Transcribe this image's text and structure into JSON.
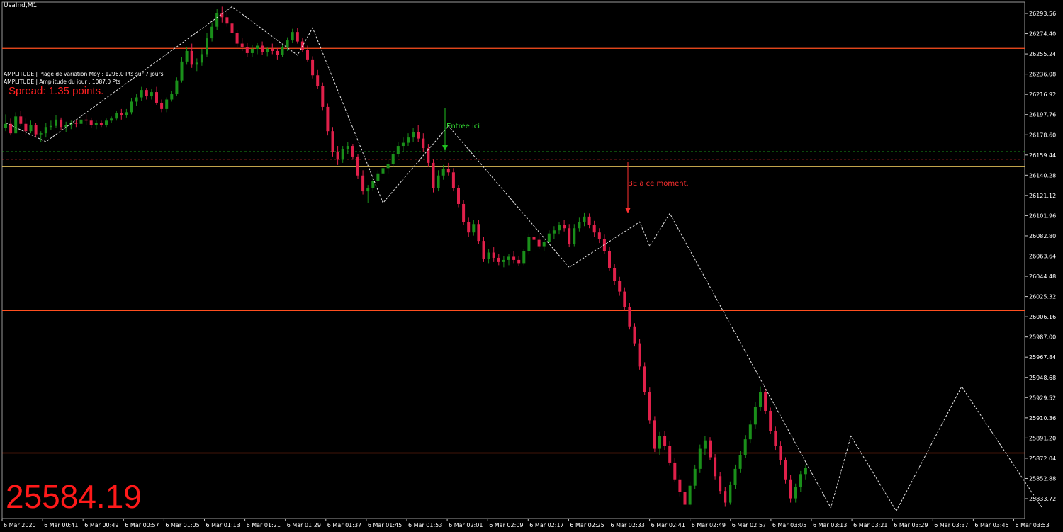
{
  "window": {
    "symbol_timeframe": "UsaInd,M1"
  },
  "overlay": {
    "amplitude_line_1": "AMPLITUDE | Plage de variation Moy : 1296.0 Pts sur 7 jours",
    "amplitude_line_2": "AMPLITUDE | Amplitude du jour : 1087.0 Pts",
    "spread": "Spread: 1.35 points.",
    "big_price": "25584.19"
  },
  "annotations": {
    "entry_label": "Entrée ici",
    "be_label": "BE à ce moment."
  },
  "colors": {
    "background": "#000000",
    "bull": "#1a8f1a",
    "bear": "#e0204a",
    "level_line": "#ff4f1f",
    "yellow_line": "#ffd966",
    "green_dotted": "#1fbf1f",
    "red_dotted": "#ff3030",
    "zigzag": "#e6e6e6",
    "text": "#ffffff",
    "price_big": "#ff1a1a"
  },
  "chart_data": {
    "type": "candlestick",
    "symbol": "UsaInd",
    "timeframe": "M1",
    "y_ticks": [
      "26293.56",
      "26274.40",
      "26255.24",
      "26236.08",
      "26216.92",
      "26197.76",
      "26178.60",
      "26159.44",
      "26140.28",
      "26121.12",
      "26101.96",
      "26082.80",
      "26063.64",
      "26044.48",
      "26025.32",
      "26006.16",
      "25987.00",
      "25967.84",
      "25948.68",
      "25929.52",
      "25910.36",
      "25891.20",
      "25872.04",
      "25852.88",
      "25833.72"
    ],
    "x_ticks": [
      "6 Mar 2020",
      "6 Mar 00:41",
      "6 Mar 00:49",
      "6 Mar 00:57",
      "6 Mar 01:05",
      "6 Mar 01:13",
      "6 Mar 01:21",
      "6 Mar 01:29",
      "6 Mar 01:37",
      "6 Mar 01:45",
      "6 Mar 01:53",
      "6 Mar 02:01",
      "6 Mar 02:09",
      "6 Mar 02:17",
      "6 Mar 02:25",
      "6 Mar 02:33",
      "6 Mar 02:41",
      "6 Mar 02:49",
      "6 Mar 02:57",
      "6 Mar 03:05",
      "6 Mar 03:13",
      "6 Mar 03:21",
      "6 Mar 03:29",
      "6 Mar 03:37",
      "6 Mar 03:45",
      "6 Mar 03:53"
    ],
    "ylim": [
      25820,
      26305
    ],
    "horizontal_levels": [
      {
        "price": 26260.5,
        "style": "solid",
        "color_key": "level_line"
      },
      {
        "price": 26148.5,
        "style": "solid",
        "color_key": "yellow_line"
      },
      {
        "price": 26162.5,
        "style": "dotted",
        "color_key": "green_dotted"
      },
      {
        "price": 26155.5,
        "style": "dotted",
        "color_key": "red_dotted"
      },
      {
        "price": 26012.0,
        "style": "solid",
        "color_key": "level_line"
      },
      {
        "price": 25877.0,
        "style": "solid",
        "color_key": "level_line"
      }
    ],
    "zigzag_points": [
      {
        "bar": 0,
        "price": 26190
      },
      {
        "bar": 8,
        "price": 26172
      },
      {
        "bar": 45,
        "price": 26300
      },
      {
        "bar": 58,
        "price": 26254
      },
      {
        "bar": 61,
        "price": 26280
      },
      {
        "bar": 75,
        "price": 26114
      },
      {
        "bar": 88,
        "price": 26187
      },
      {
        "bar": 112,
        "price": 26053
      },
      {
        "bar": 126,
        "price": 26096
      },
      {
        "bar": 128,
        "price": 26073
      },
      {
        "bar": 132,
        "price": 26104
      },
      {
        "bar": 164,
        "price": 25825
      },
      {
        "bar": 168,
        "price": 25893
      },
      {
        "bar": 177,
        "price": 25822
      },
      {
        "bar": 190,
        "price": 25940
      },
      {
        "bar": 206,
        "price": 25825
      }
    ],
    "candles": [
      [
        26185,
        26198,
        26182,
        26189
      ],
      [
        26189,
        26194,
        26178,
        26180
      ],
      [
        26180,
        26200,
        26180,
        26196
      ],
      [
        26196,
        26201,
        26187,
        26189
      ],
      [
        26189,
        26194,
        26178,
        26182
      ],
      [
        26182,
        26192,
        26180,
        26188
      ],
      [
        26188,
        26190,
        26176,
        26179
      ],
      [
        26179,
        26182,
        26172,
        26180
      ],
      [
        26180,
        26190,
        26176,
        26186
      ],
      [
        26186,
        26192,
        26183,
        26187
      ],
      [
        26187,
        26197,
        26185,
        26193
      ],
      [
        26193,
        26195,
        26183,
        26186
      ],
      [
        26186,
        26191,
        26181,
        26188
      ],
      [
        26188,
        26192,
        26184,
        26190
      ],
      [
        26190,
        26193,
        26186,
        26189
      ],
      [
        26189,
        26196,
        26187,
        26193
      ],
      [
        26193,
        26198,
        26188,
        26192
      ],
      [
        26192,
        26195,
        26185,
        26188
      ],
      [
        26188,
        26192,
        26184,
        26190
      ],
      [
        26190,
        26192,
        26186,
        26188
      ],
      [
        26188,
        26194,
        26186,
        26192
      ],
      [
        26192,
        26196,
        26190,
        26194
      ],
      [
        26194,
        26201,
        26192,
        26199
      ],
      [
        26199,
        26203,
        26193,
        26197
      ],
      [
        26197,
        26203,
        26195,
        26200
      ],
      [
        26200,
        26213,
        26198,
        26210
      ],
      [
        26210,
        26217,
        26206,
        26214
      ],
      [
        26214,
        26224,
        26211,
        26221
      ],
      [
        26221,
        26223,
        26212,
        26215
      ],
      [
        26215,
        26222,
        26212,
        26219
      ],
      [
        26219,
        26224,
        26207,
        26209
      ],
      [
        26209,
        26212,
        26200,
        26203
      ],
      [
        26203,
        26214,
        26200,
        26212
      ],
      [
        26212,
        26220,
        26210,
        26217
      ],
      [
        26217,
        26233,
        26215,
        26230
      ],
      [
        26230,
        26252,
        26228,
        26248
      ],
      [
        26248,
        26262,
        26245,
        26258
      ],
      [
        26258,
        26265,
        26242,
        26245
      ],
      [
        26245,
        26251,
        26239,
        26247
      ],
      [
        26247,
        26260,
        26244,
        26255
      ],
      [
        26255,
        26275,
        26252,
        26270
      ],
      [
        26270,
        26285,
        26267,
        26281
      ],
      [
        26281,
        26298,
        26278,
        26294
      ],
      [
        26294,
        26300,
        26285,
        26290
      ],
      [
        26290,
        26296,
        26281,
        26284
      ],
      [
        26284,
        26290,
        26272,
        26275
      ],
      [
        26275,
        26278,
        26262,
        26265
      ],
      [
        26265,
        26270,
        26258,
        26262
      ],
      [
        26262,
        26266,
        26252,
        26256
      ],
      [
        26256,
        26264,
        26252,
        26260
      ],
      [
        26260,
        26266,
        26255,
        26263
      ],
      [
        26263,
        26267,
        26254,
        26257
      ],
      [
        26257,
        26262,
        26253,
        26260
      ],
      [
        26260,
        26265,
        26255,
        26258
      ],
      [
        26258,
        26261,
        26250,
        26254
      ],
      [
        26254,
        26264,
        26252,
        26262
      ],
      [
        26262,
        26271,
        26258,
        26268
      ],
      [
        26268,
        26279,
        26266,
        26276
      ],
      [
        26276,
        26280,
        26265,
        26267
      ],
      [
        26267,
        26270,
        26257,
        26259
      ],
      [
        26259,
        26263,
        26248,
        26250
      ],
      [
        26250,
        26253,
        26232,
        26235
      ],
      [
        26235,
        26240,
        26222,
        26225
      ],
      [
        26225,
        26228,
        26202,
        26205
      ],
      [
        26205,
        26208,
        26178,
        26182
      ],
      [
        26182,
        26186,
        26158,
        26162
      ],
      [
        26162,
        26168,
        26150,
        26155
      ],
      [
        26155,
        26168,
        26152,
        26165
      ],
      [
        26165,
        26172,
        26160,
        26168
      ],
      [
        26168,
        26170,
        26155,
        26158
      ],
      [
        26158,
        26160,
        26137,
        26140
      ],
      [
        26140,
        26145,
        26122,
        26125
      ],
      [
        26125,
        26131,
        26114,
        26128
      ],
      [
        26128,
        26138,
        26125,
        26135
      ],
      [
        26135,
        26145,
        26132,
        26142
      ],
      [
        26142,
        26150,
        26138,
        26147
      ],
      [
        26147,
        26155,
        26142,
        26151
      ],
      [
        26151,
        26163,
        26148,
        26160
      ],
      [
        26160,
        26172,
        26158,
        26168
      ],
      [
        26168,
        26176,
        26163,
        26171
      ],
      [
        26171,
        26180,
        26168,
        26176
      ],
      [
        26176,
        26185,
        26172,
        26181
      ],
      [
        26181,
        26188,
        26172,
        26175
      ],
      [
        26175,
        26180,
        26162,
        26166
      ],
      [
        26166,
        26170,
        26148,
        26152
      ],
      [
        26152,
        26155,
        26124,
        26128
      ],
      [
        26128,
        26145,
        26125,
        26140
      ],
      [
        26140,
        26150,
        26136,
        26146
      ],
      [
        26146,
        26152,
        26140,
        26143
      ],
      [
        26143,
        26147,
        26125,
        26128
      ],
      [
        26128,
        26131,
        26110,
        26113
      ],
      [
        26113,
        26117,
        26093,
        26096
      ],
      [
        26096,
        26100,
        26082,
        26086
      ],
      [
        26086,
        26098,
        26083,
        26094
      ],
      [
        26094,
        26098,
        26075,
        26078
      ],
      [
        26078,
        26082,
        26058,
        26061
      ],
      [
        26061,
        26070,
        26057,
        26067
      ],
      [
        26067,
        26072,
        26058,
        26062
      ],
      [
        26062,
        26066,
        26055,
        26058
      ],
      [
        26058,
        26064,
        26053,
        26060
      ],
      [
        26060,
        26066,
        26055,
        26063
      ],
      [
        26063,
        26068,
        26057,
        26060
      ],
      [
        26060,
        26064,
        26054,
        26057
      ],
      [
        26057,
        26070,
        26055,
        26068
      ],
      [
        26068,
        26085,
        26065,
        26082
      ],
      [
        26082,
        26090,
        26076,
        26079
      ],
      [
        26079,
        26084,
        26070,
        26073
      ],
      [
        26073,
        26080,
        26068,
        26077
      ],
      [
        26077,
        26088,
        26074,
        26085
      ],
      [
        26085,
        26092,
        26080,
        26088
      ],
      [
        26088,
        26096,
        26084,
        26093
      ],
      [
        26093,
        26098,
        26087,
        26090
      ],
      [
        26090,
        26094,
        26072,
        26075
      ],
      [
        26075,
        26094,
        26073,
        26090
      ],
      [
        26090,
        26100,
        26087,
        26096
      ],
      [
        26096,
        26105,
        26092,
        26101
      ],
      [
        26101,
        26104,
        26090,
        26093
      ],
      [
        26093,
        26097,
        26082,
        26086
      ],
      [
        26086,
        26090,
        26076,
        26080
      ],
      [
        26080,
        26084,
        26066,
        26068
      ],
      [
        26068,
        26072,
        26050,
        26052
      ],
      [
        26052,
        26056,
        26036,
        26040
      ],
      [
        26040,
        26044,
        26026,
        26030
      ],
      [
        26030,
        26034,
        26012,
        26015
      ],
      [
        26015,
        26019,
        25994,
        25997
      ],
      [
        25997,
        26000,
        25978,
        25981
      ],
      [
        25981,
        25985,
        25956,
        25959
      ],
      [
        25959,
        25963,
        25932,
        25935
      ],
      [
        25935,
        25939,
        25905,
        25908
      ],
      [
        25908,
        25912,
        25878,
        25881
      ],
      [
        25881,
        25897,
        25875,
        25893
      ],
      [
        25893,
        25898,
        25880,
        25884
      ],
      [
        25884,
        25888,
        25865,
        25868
      ],
      [
        25868,
        25872,
        25850,
        25852
      ],
      [
        25852,
        25856,
        25836,
        25840
      ],
      [
        25840,
        25844,
        25825,
        25828
      ],
      [
        25828,
        25850,
        25826,
        25846
      ],
      [
        25846,
        25866,
        25843,
        25862
      ],
      [
        25862,
        25885,
        25858,
        25881
      ],
      [
        25881,
        25893,
        25875,
        25889
      ],
      [
        25889,
        25892,
        25870,
        25873
      ],
      [
        25873,
        25876,
        25852,
        25855
      ],
      [
        25855,
        25859,
        25838,
        25841
      ],
      [
        25841,
        25845,
        25826,
        25830
      ],
      [
        25830,
        25850,
        25828,
        25847
      ],
      [
        25847,
        25866,
        25843,
        25862
      ],
      [
        25862,
        25879,
        25858,
        25875
      ],
      [
        25875,
        25894,
        25872,
        25890
      ],
      [
        25890,
        25908,
        25886,
        25904
      ],
      [
        25904,
        25925,
        25900,
        25921
      ],
      [
        25921,
        25940,
        25917,
        25935
      ],
      [
        25935,
        25938,
        25914,
        25917
      ],
      [
        25917,
        25920,
        25895,
        25898
      ],
      [
        25898,
        25902,
        25880,
        25884
      ],
      [
        25884,
        25888,
        25866,
        25870
      ],
      [
        25870,
        25873,
        25848,
        25852
      ],
      [
        25852,
        25856,
        25830,
        25834
      ],
      [
        25834,
        25848,
        25830,
        25845
      ],
      [
        25845,
        25860,
        25840,
        25857
      ],
      [
        25857,
        25866,
        25852,
        25863
      ]
    ]
  }
}
